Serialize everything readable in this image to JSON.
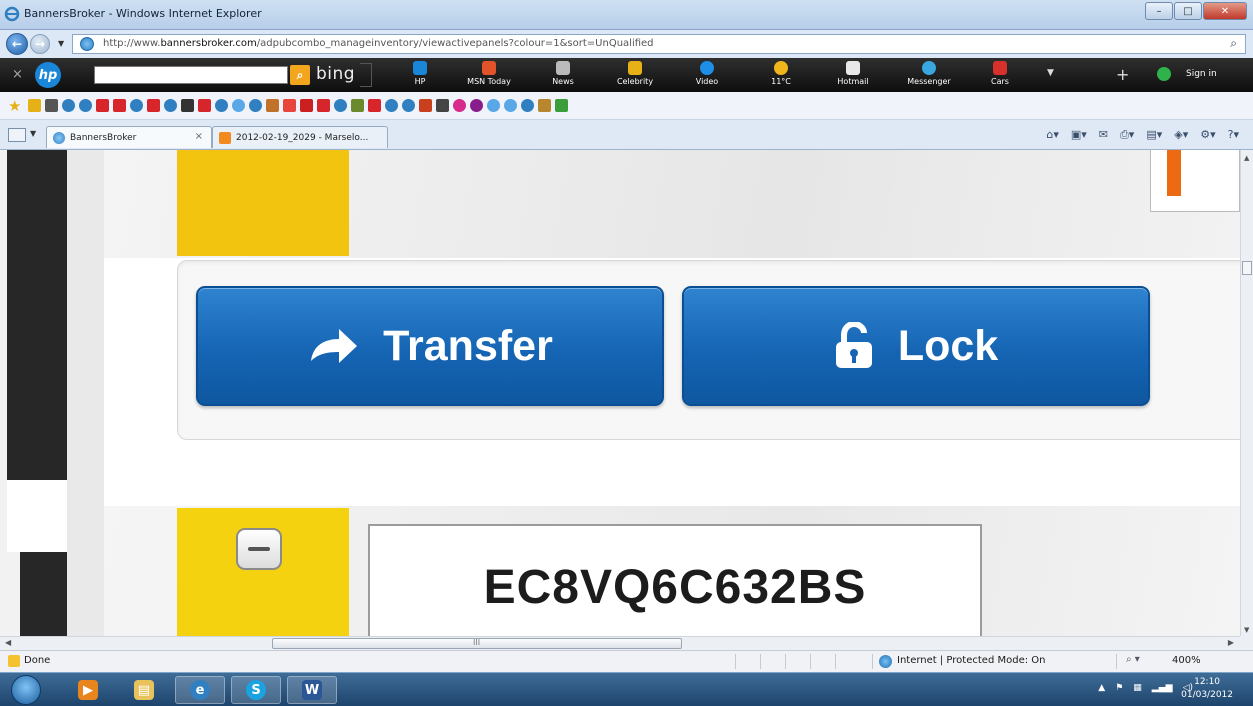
{
  "window": {
    "title": "BannersBroker - Windows Internet Explorer",
    "min_glyph": "–",
    "max_glyph": "□",
    "close_glyph": "✕"
  },
  "address": {
    "url_prefix": "http://www.",
    "url_domain": "bannersbroker.com",
    "url_path": "/adpubcombo_manageinventory/viewactivepanels?colour=1&sort=UnQualified"
  },
  "hp_toolbar": {
    "close_glyph": "×",
    "logo_text": "hp",
    "search_placeholder": "",
    "bing_label": "bing",
    "items": [
      {
        "label": "HP",
        "color": "#1a86d8"
      },
      {
        "label": "MSN Today",
        "color": "#e0532b"
      },
      {
        "label": "News",
        "color": "#bbbbbb"
      },
      {
        "label": "Celebrity",
        "color": "#e6b117"
      },
      {
        "label": "Video",
        "color": "#1f8ee6"
      },
      {
        "label": "11°C",
        "color": "#f0b51a"
      },
      {
        "label": "Hotmail",
        "color": "#e8e8e8"
      },
      {
        "label": "Messenger",
        "color": "#3aa6e0"
      },
      {
        "label": "Cars",
        "color": "#d6312b"
      }
    ],
    "plus_glyph": "+",
    "sign_in_label": "Sign in"
  },
  "tabs": [
    {
      "label": "BannersBroker",
      "close_glyph": "×"
    },
    {
      "label": "2012-02-19_2029 - Marselo..."
    }
  ],
  "content": {
    "transfer_label": "Transfer",
    "lock_label": "Lock",
    "code": "EC8VQ6C632BS"
  },
  "scroll": {
    "grip": "III"
  },
  "status": {
    "left_text": "Done",
    "zone_text": "Internet | Protected Mode: On",
    "zoom_text": "400%"
  },
  "taskbar": {
    "time": "12:10",
    "date": "01/03/2012"
  },
  "colors": {
    "accent_yellow": "#f2c40f",
    "button_blue": "#1565b4",
    "orange_marker": "#ec6b12"
  }
}
